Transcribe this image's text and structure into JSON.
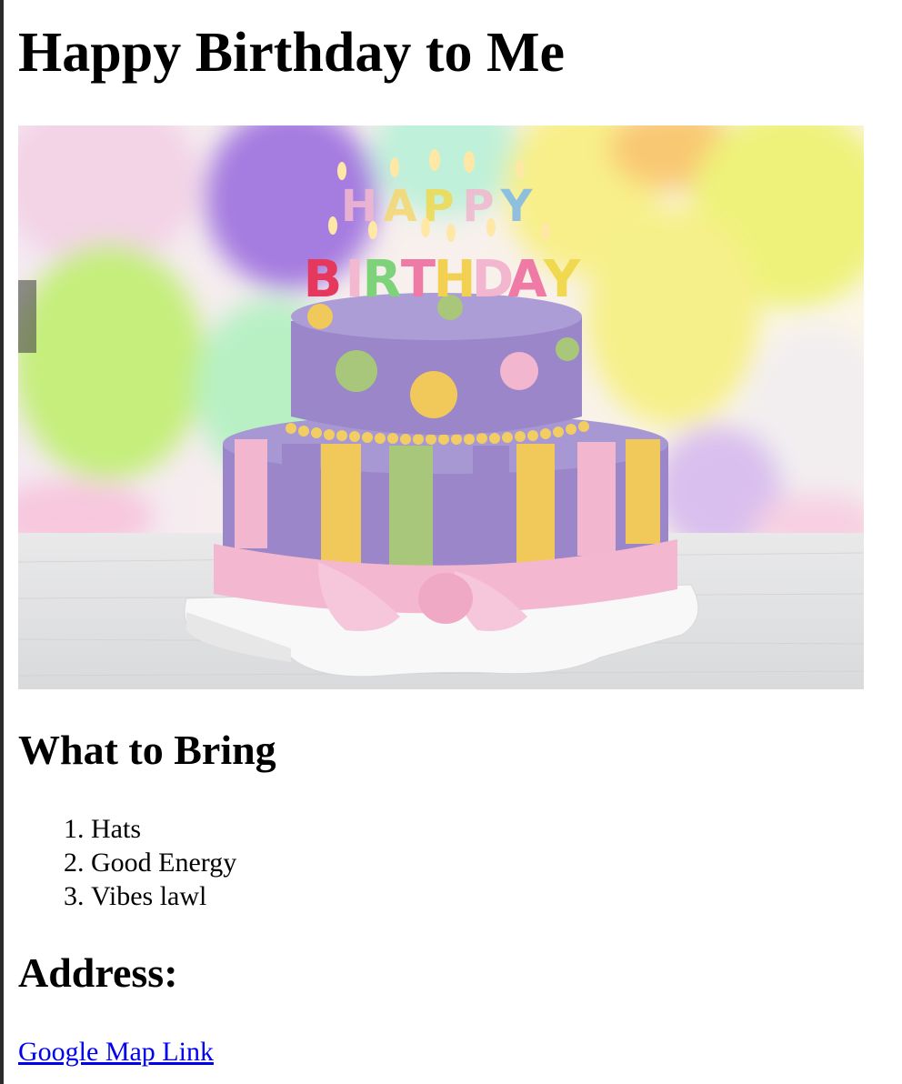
{
  "page": {
    "title": "Happy Birthday to Me"
  },
  "hero_image": {
    "alt": "Two-tier birthday cake with HAPPY BIRTHDAY candles",
    "candle_top_text": "HAPPY",
    "candle_bottom_text": "BIRTHDAY",
    "icon": "birthday-cake-image"
  },
  "bring_section": {
    "heading": "What to Bring",
    "items": [
      "Hats",
      "Good Energy",
      "Vibes lawl"
    ]
  },
  "address_section": {
    "heading": "Address:",
    "link_label": "Google Map Link"
  },
  "colors": {
    "link": "#0000ee",
    "cake_purple": "#9a86c9",
    "cake_pink": "#f2b6cf",
    "cake_yellow": "#f1c95a",
    "cake_green": "#a9c77a"
  }
}
